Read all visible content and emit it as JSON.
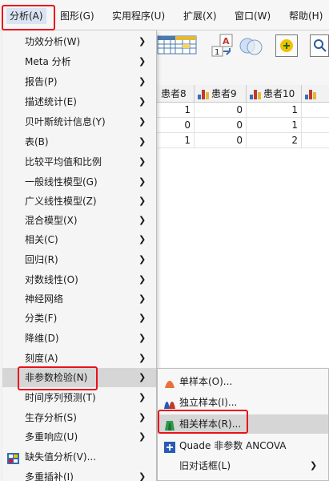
{
  "menubar": {
    "items": [
      "分析(A)",
      "图形(G)",
      "实用程序(U)",
      "扩展(X)",
      "窗口(W)",
      "帮助(H)"
    ]
  },
  "grid": {
    "headers": [
      "患者8",
      "患者9",
      "患者10"
    ],
    "rows": [
      [
        "1",
        "0",
        "1"
      ],
      [
        "0",
        "0",
        "1"
      ],
      [
        "1",
        "0",
        "2"
      ]
    ]
  },
  "analyze_menu": {
    "items": [
      {
        "label": "功效分析(W)",
        "submenu": true
      },
      {
        "label": "Meta 分析",
        "submenu": true
      },
      {
        "label": "报告(P)",
        "submenu": true
      },
      {
        "label": "描述统计(E)",
        "submenu": true
      },
      {
        "label": "贝叶斯统计信息(Y)",
        "submenu": true
      },
      {
        "label": "表(B)",
        "submenu": true
      },
      {
        "label": "比较平均值和比例",
        "submenu": true
      },
      {
        "label": "一般线性模型(G)",
        "submenu": true
      },
      {
        "label": "广义线性模型(Z)",
        "submenu": true
      },
      {
        "label": "混合模型(X)",
        "submenu": true
      },
      {
        "label": "相关(C)",
        "submenu": true
      },
      {
        "label": "回归(R)",
        "submenu": true
      },
      {
        "label": "对数线性(O)",
        "submenu": true
      },
      {
        "label": "神经网络",
        "submenu": true
      },
      {
        "label": "分类(F)",
        "submenu": true
      },
      {
        "label": "降维(D)",
        "submenu": true
      },
      {
        "label": "刻度(A)",
        "submenu": true
      },
      {
        "label": "非参数检验(N)",
        "submenu": true
      },
      {
        "label": "时间序列预测(T)",
        "submenu": true
      },
      {
        "label": "生存分析(S)",
        "submenu": true
      },
      {
        "label": "多重响应(U)",
        "submenu": true
      },
      {
        "label": "缺失值分析(V)...",
        "submenu": false,
        "icon": "missing-value-icon"
      },
      {
        "label": "多重插补(I)",
        "submenu": true
      }
    ]
  },
  "nonparam_submenu": {
    "items": [
      {
        "label": "单样本(O)...",
        "icon": "one-sample-icon",
        "submenu": false
      },
      {
        "label": "独立样本(I)...",
        "icon": "independent-samples-icon",
        "submenu": false
      },
      {
        "label": "相关样本(R)...",
        "icon": "related-samples-icon",
        "submenu": false
      },
      {
        "label": "Quade 非参数 ANCOVA",
        "icon": "quade-ancova-icon",
        "submenu": false
      },
      {
        "label": "旧对话框(L)",
        "submenu": true
      }
    ]
  },
  "colors": {
    "highlight_box": "#e8121b",
    "menu_hover": "#d6d6d6"
  }
}
